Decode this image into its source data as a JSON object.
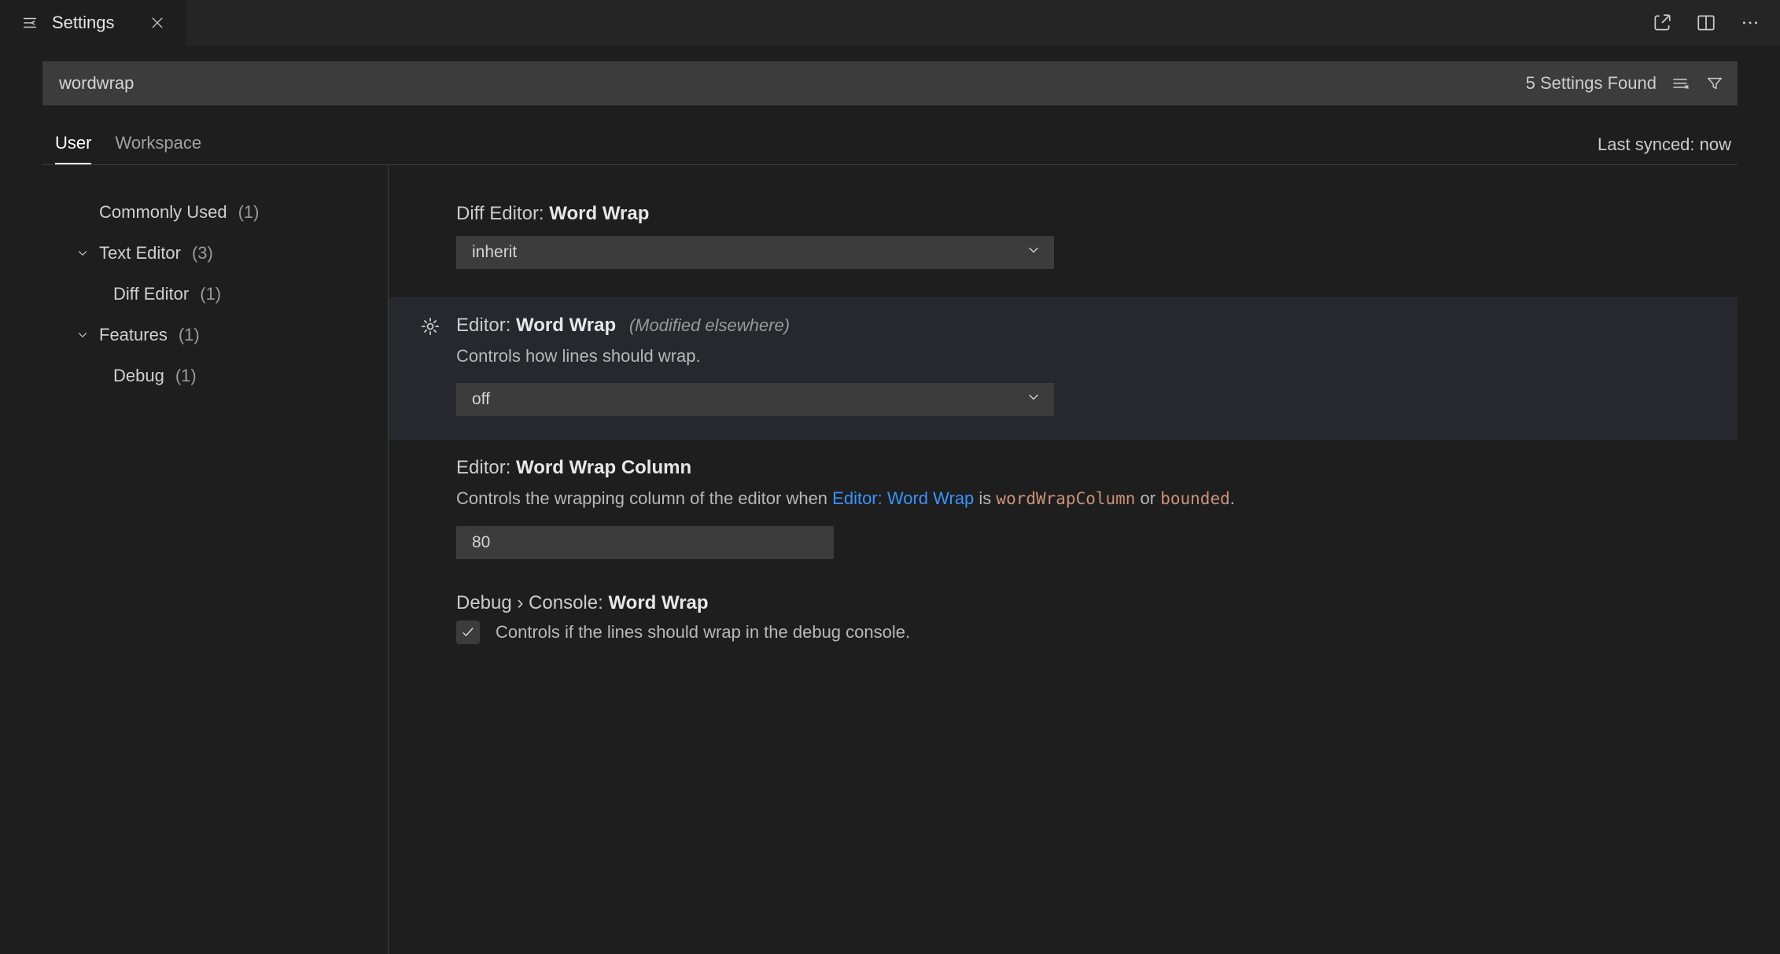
{
  "tabbar": {
    "active_tab_label": "Settings"
  },
  "search": {
    "value": "wordwrap",
    "count_label": "5 Settings Found"
  },
  "scope": {
    "tabs": {
      "user": "User",
      "workspace": "Workspace"
    },
    "sync_label": "Last synced: now"
  },
  "sidebar": {
    "items": [
      {
        "label": "Commonly Used",
        "count": "(1)"
      },
      {
        "label": "Text Editor",
        "count": "(3)"
      },
      {
        "label": "Diff Editor",
        "count": "(1)"
      },
      {
        "label": "Features",
        "count": "(1)"
      },
      {
        "label": "Debug",
        "count": "(1)"
      }
    ]
  },
  "settings": {
    "diff": {
      "title_prefix": "Diff Editor: ",
      "title_bold": "Word Wrap",
      "value": "inherit"
    },
    "editor_wrap": {
      "title_prefix": "Editor: ",
      "title_bold": "Word Wrap",
      "badge": "(Modified elsewhere)",
      "desc": "Controls how lines should wrap.",
      "value": "off"
    },
    "wrap_column": {
      "title_prefix": "Editor: ",
      "title_bold": "Word Wrap Column",
      "desc_pre": "Controls the wrapping column of the editor when ",
      "desc_link": "Editor: Word Wrap",
      "desc_mid": " is ",
      "code1": "wordWrapColumn",
      "desc_or": " or ",
      "code2": "bounded",
      "desc_end": ".",
      "value": "80"
    },
    "debug_wrap": {
      "title_prefix": "Debug › Console: ",
      "title_bold": "Word Wrap",
      "desc": "Controls if the lines should wrap in the debug console.",
      "checked": true
    }
  }
}
